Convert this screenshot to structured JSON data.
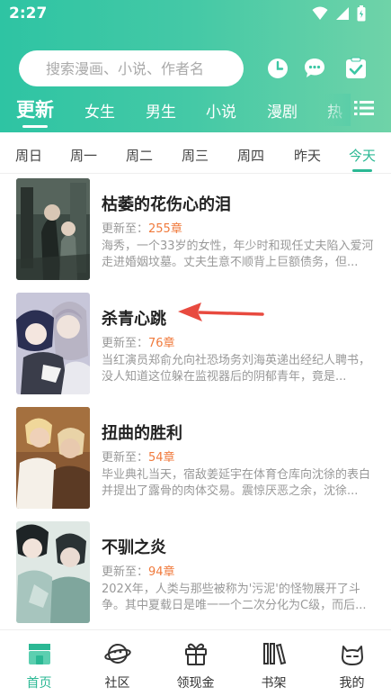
{
  "status": {
    "time": "2:27"
  },
  "search": {
    "placeholder": "搜索漫画、小说、作者名"
  },
  "header_icons": [
    "clock-icon",
    "chat-icon",
    "checklist-icon"
  ],
  "top_tabs": [
    "更新",
    "女生",
    "男生",
    "小说",
    "漫剧",
    "热"
  ],
  "day_tabs": [
    "周日",
    "周一",
    "周二",
    "周三",
    "周四",
    "昨天",
    "今天"
  ],
  "items": [
    {
      "title": "枯萎的花伤心的泪",
      "update_label": "更新至：",
      "chapter": "255章",
      "desc": "海秀，一个33岁的女性，年少时和现任丈夫陷入爱河走进婚姻坟墓。丈夫生意不顺背上巨额债务，但..."
    },
    {
      "title": "杀青心跳",
      "update_label": "更新至：",
      "chapter": "76章",
      "desc": "当红演员郑俞允向社恐场务刘海英递出经纪人聘书，没人知道这位躲在监视器后的阴郁青年，竟是..."
    },
    {
      "title": "扭曲的胜利",
      "update_label": "更新至：",
      "chapter": "54章",
      "desc": "毕业典礼当天，宿敌姜延宇在体育仓库向沈徐的表白并提出了露骨的肉体交易。震惊厌恶之余，沈徐..."
    },
    {
      "title": "不驯之炎",
      "update_label": "更新至：",
      "chapter": "94章",
      "desc": "202X年，人类与那些被称为'污泥'的怪物展开了斗争。其中夏载日是唯一一个二次分化为C级，而后..."
    }
  ],
  "bottom_nav": [
    {
      "label": "首页",
      "icon": "home-icon",
      "active": true
    },
    {
      "label": "社区",
      "icon": "planet-icon",
      "active": false
    },
    {
      "label": "领现金",
      "icon": "gift-icon",
      "active": false
    },
    {
      "label": "书架",
      "icon": "bookshelf-icon",
      "active": false
    },
    {
      "label": "我的",
      "icon": "profile-cat-icon",
      "active": false
    }
  ],
  "colors": {
    "accent": "#2bb894",
    "header_start": "#2ec4a3",
    "header_end": "#6fd3a8",
    "chapter": "#f07a3c",
    "annotation_arrow": "#e84a3f"
  }
}
